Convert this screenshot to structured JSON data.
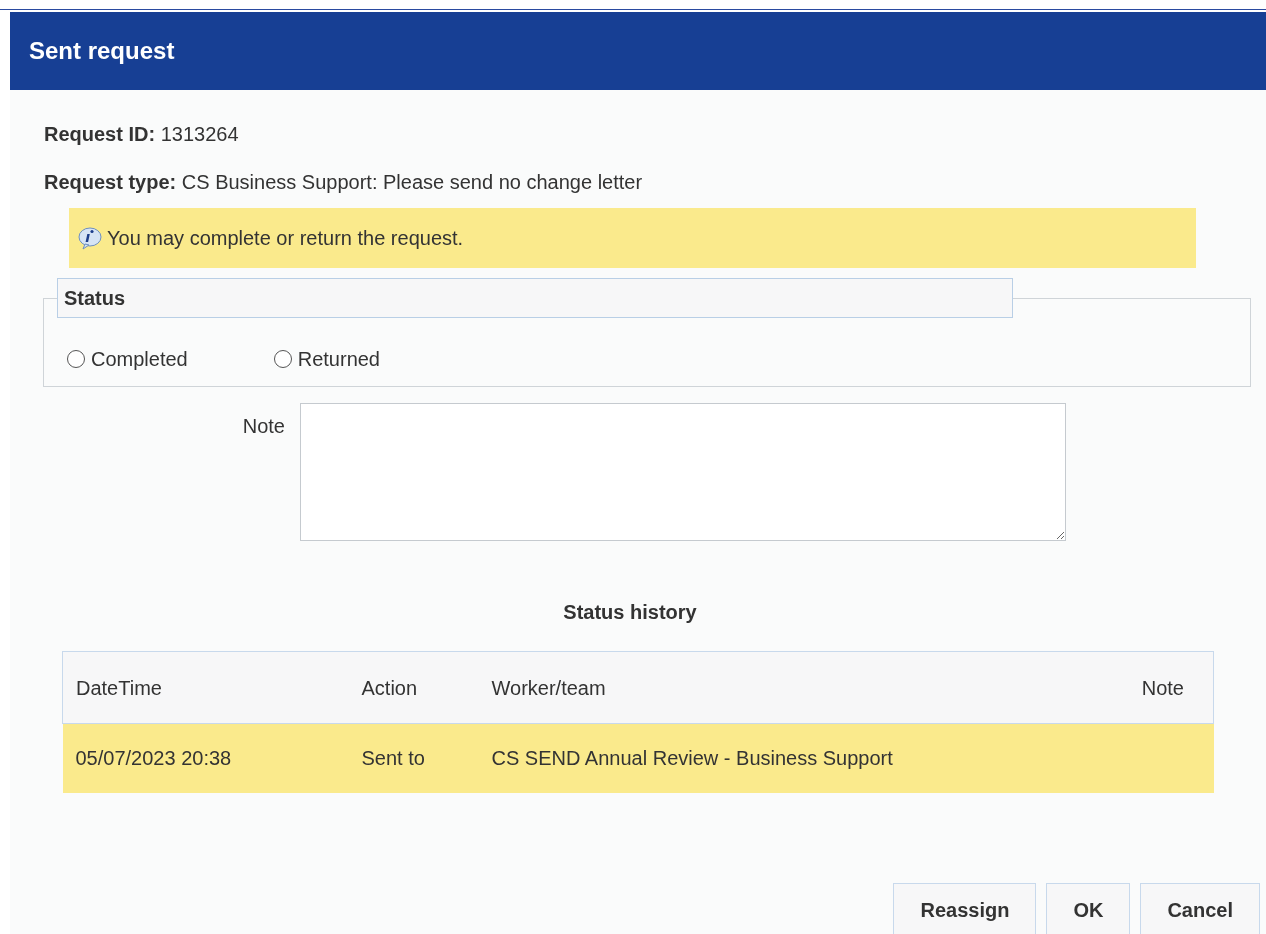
{
  "window": {
    "title": "Sent request"
  },
  "details": [
    "**Request ID:** 1313264",
    "**Request type:** CS Business Support: Please send no change letter"
  ],
  "notice": "You may complete or return the request.",
  "status": {
    "legend": "Status",
    "options": [
      {
        "label": "Completed",
        "selected": false
      },
      {
        "label": "Returned",
        "selected": false
      }
    ]
  },
  "note": {
    "label": "Note"
  },
  "history": {
    "title": "Status history",
    "columns": [
      "DateTime",
      "Action",
      "Worker/team",
      "Note"
    ],
    "rows": [
      {
        "cells": [
          "05/07/2023 20:38",
          "Sent to",
          "CS SEND Annual Review - Business Support",
          ""
        ],
        "selected": true
      }
    ]
  },
  "buttons": [
    "Reassign",
    "OK",
    "Cancel"
  ]
}
